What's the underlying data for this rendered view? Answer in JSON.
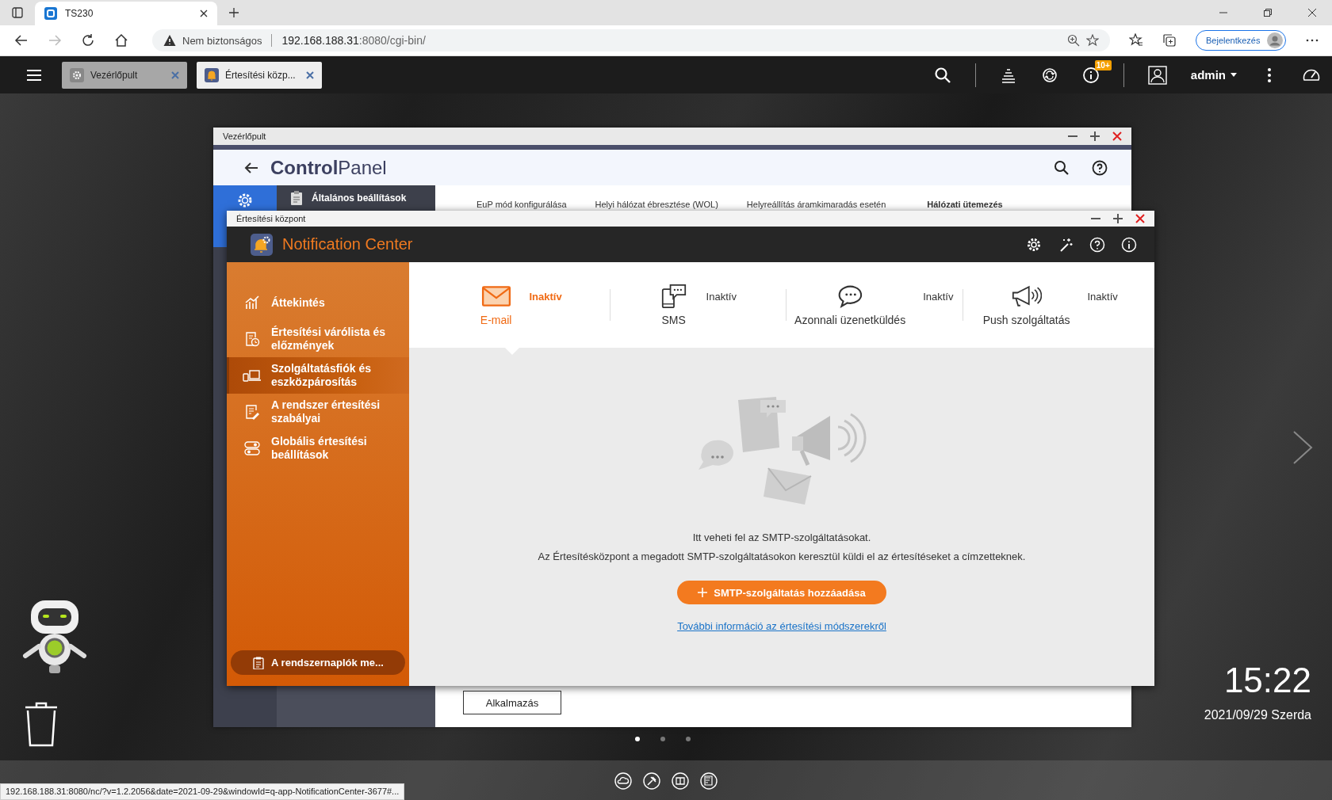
{
  "browser": {
    "tab_title": "TS230",
    "security": "Nem biztonságos",
    "url_host": "192.168.188.31",
    "url_rest": ":8080/cgi-bin/",
    "sign_in": "Bejelentkezés"
  },
  "qts_bar": {
    "tabs": [
      {
        "label": "Vezérlőpult",
        "selected": false
      },
      {
        "label": "Értesítési közp...",
        "selected": true
      }
    ],
    "badge": "10+",
    "user": "admin"
  },
  "control_panel": {
    "title": "Vezérlőpult",
    "heading": "**Control**Panel",
    "section": "Általános beállítások",
    "tabs": [
      {
        "label": "EuP mód konfigurálása",
        "selected": false
      },
      {
        "label": "Helyi hálózat ébresztése (WOL)",
        "selected": false
      },
      {
        "label": "Helyreállítás áramkimaradás esetén",
        "selected": false
      },
      {
        "label": "Hálózati ütemezés",
        "selected": true
      }
    ],
    "apply": "Alkalmazás"
  },
  "notification_center": {
    "window_title": "Értesítési központ",
    "app_title": "Notification Center",
    "nav": [
      {
        "kind": "overview",
        "label": "Áttekintés",
        "selected": false
      },
      {
        "kind": "queue",
        "label": "Értesítési várólista és előzmények",
        "selected": false
      },
      {
        "kind": "devices",
        "label": "Szolgáltatásfiók és eszközpárosítás",
        "selected": true
      },
      {
        "kind": "rules",
        "label": "A rendszer értesítési szabályai",
        "selected": false
      },
      {
        "kind": "settings",
        "label": "Globális értesítési beállítások",
        "selected": false
      }
    ],
    "log_button": "A rendszernaplók me...",
    "channels": [
      {
        "kind": "email",
        "name": "E-mail",
        "status": "Inaktív",
        "selected": true
      },
      {
        "kind": "sms",
        "name": "SMS",
        "status": "Inaktív",
        "selected": false
      },
      {
        "kind": "im",
        "name": "Azonnali üzenetküldés",
        "status": "Inaktív",
        "selected": false
      },
      {
        "kind": "push",
        "name": "Push szolgáltatás",
        "status": "Inaktív",
        "selected": false
      }
    ],
    "message": [
      "Itt veheti fel az SMTP-szolgáltatásokat.",
      "Az Értesítésközpont a megadott SMTP-szolgáltatásokon keresztül küldi el az értesítéseket a címzetteknek."
    ],
    "add_button": "SMTP-szolgáltatás hozzáadása",
    "link": "További információ az értesítési módszerekről"
  },
  "desktop": {
    "clock": "15:22",
    "date": "2021/09/29 Szerda",
    "pages": [
      {
        "selected": true
      },
      {
        "selected": false
      },
      {
        "selected": false
      }
    ]
  },
  "status_url": "192.168.188.31:8080/nc/?v=1.2.2056&date=2021-09-29&windowId=q-app-NotificationCenter-3677#..."
}
